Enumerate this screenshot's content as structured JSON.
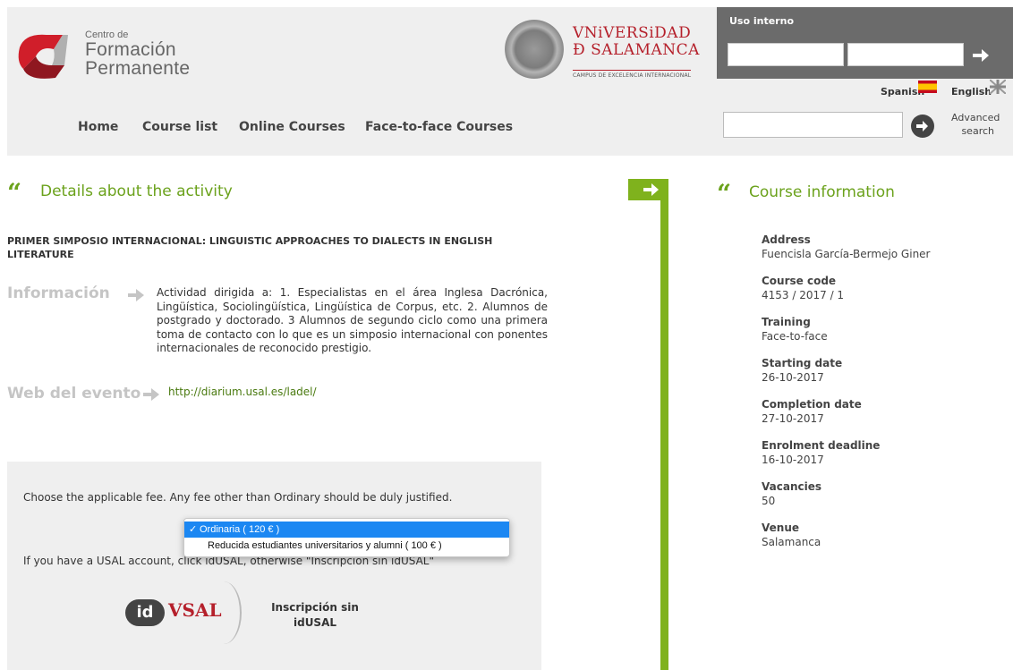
{
  "header": {
    "logo": {
      "line1": "Centro de",
      "line2": "Formación",
      "line3": "Permanente"
    },
    "university": {
      "line1": "VNiVERSiDAD",
      "line2": "Ð SALAMANCA",
      "sub": "CAMPUS DE EXCELENCIA INTERNACIONAL"
    },
    "uso_interno": {
      "title": "Uso interno",
      "go_icon": "arrow-right-icon"
    },
    "languages": [
      {
        "label": "Spanish",
        "flag": "flag-spain-icon"
      },
      {
        "label": "English",
        "flag": "flag-uk-icon"
      }
    ],
    "nav": [
      "Home",
      "Course list",
      "Online Courses",
      "Face-to-face Courses"
    ],
    "search": {
      "placeholder": "",
      "go_icon": "circle-arrow-right-icon",
      "advanced": "Advanced search"
    }
  },
  "details": {
    "title": "Details about the activity",
    "activity_name": "PRIMER SIMPOSIO INTERNACIONAL: LINGUISTIC APPROACHES TO DIALECTS IN ENGLISH LITERATURE",
    "info_label": "Información",
    "info_text": "Actividad dirigida a: 1. Especialistas en el área Inglesa Dacrónica, Lingüística, Sociolingüística, Lingüística de Corpus, etc. 2. Alumnos de postgrado y doctorado. 3 Alumnos de segundo ciclo como una primera toma de contacto con lo que es un simposio internacional con ponentes internacionales de reconocido prestigio.",
    "web_label": "Web del evento",
    "web_url": "http://diarium.usal.es/ladel/"
  },
  "fee": {
    "instruction": "Choose the applicable fee. Any fee other than Ordinary should be duly justified.",
    "options": [
      "Ordinaria ( 120 € )",
      "Reducida estudiantes universitarios y alumni ( 100 € )"
    ],
    "selected_index": 0,
    "account_text": "If you have a USAL account, click idUSAL, otherwise \"Inscripción sin idUSAL\"",
    "idusal": {
      "badge": "id",
      "text": "VSAL"
    },
    "sin_id": "Inscripción sin idUSAL"
  },
  "course_info": {
    "title": "Course information",
    "items": [
      {
        "label": "Address",
        "value": "Fuencisla García-Bermejo Giner"
      },
      {
        "label": "Course code",
        "value": "4153 / 2017 / 1"
      },
      {
        "label": "Training",
        "value": "Face-to-face"
      },
      {
        "label": "Starting date",
        "value": "26-10-2017"
      },
      {
        "label": "Completion date",
        "value": "27-10-2017"
      },
      {
        "label": "Enrolment deadline",
        "value": "16-10-2017"
      },
      {
        "label": "Vacancies",
        "value": "50"
      },
      {
        "label": "Venue",
        "value": "Salamanca"
      }
    ]
  },
  "colors": {
    "accent_green": "#7fb21d",
    "usal_red": "#b5202b",
    "select_blue": "#1b87f2",
    "header_bg": "#efefef",
    "uso_bg": "#6b6b6b"
  }
}
